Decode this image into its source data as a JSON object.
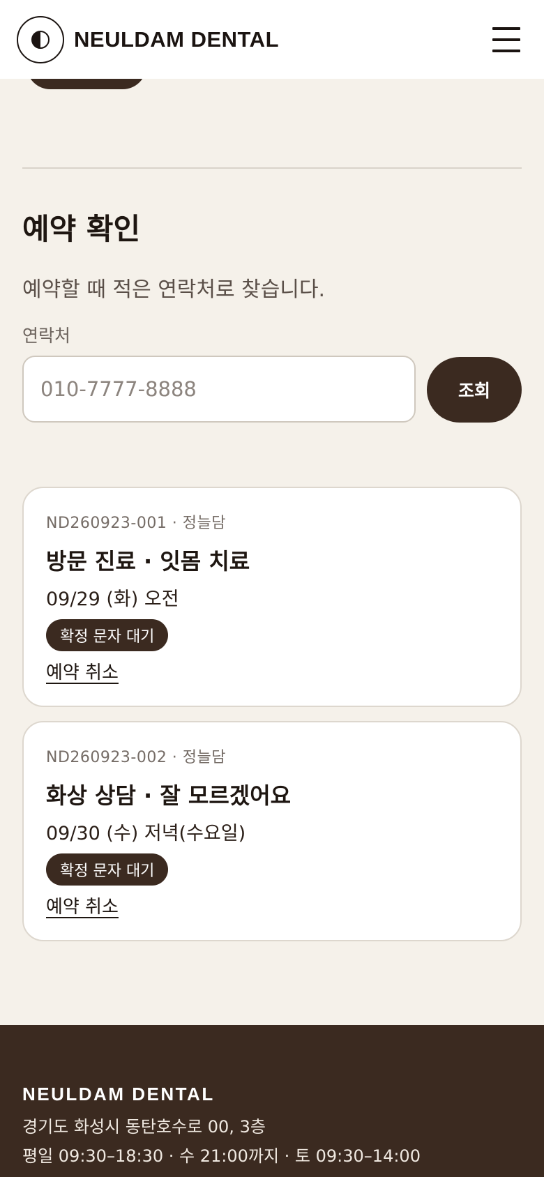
{
  "header": {
    "brand": "NEULDAM DENTAL",
    "menu_icon": "hamburger-menu-icon",
    "logo_icon": "half-moon-icon"
  },
  "lookup": {
    "title": "예약 확인",
    "description": "예약할 때 적은 연락처로 찾습니다.",
    "field_label": "연락처",
    "phone_placeholder": "010-7777-8888",
    "search_label": "조회"
  },
  "reservations": [
    {
      "ref": "ND260923-001 · 정늘담",
      "title": "방문 진료 · 잇몸 치료",
      "datetime": "09/29 (화) 오전",
      "status": "확정 문자 대기",
      "cancel_label": "예약 취소"
    },
    {
      "ref": "ND260923-002 · 정늘담",
      "title": "화상 상담 · 잘 모르겠어요",
      "datetime": "09/30 (수) 저녁(수요일)",
      "status": "확정 문자 대기",
      "cancel_label": "예약 취소"
    }
  ],
  "footer": {
    "brand": "NEULDAM DENTAL",
    "address": "경기도 화성시 동탄호수로 00, 3층",
    "hours": "평일 09:30–18:30 · 수 21:00까지 · 토 09:30–14:00"
  },
  "colors": {
    "background": "#f5f1ea",
    "accent": "#3b2a20",
    "card": "#ffffff"
  }
}
